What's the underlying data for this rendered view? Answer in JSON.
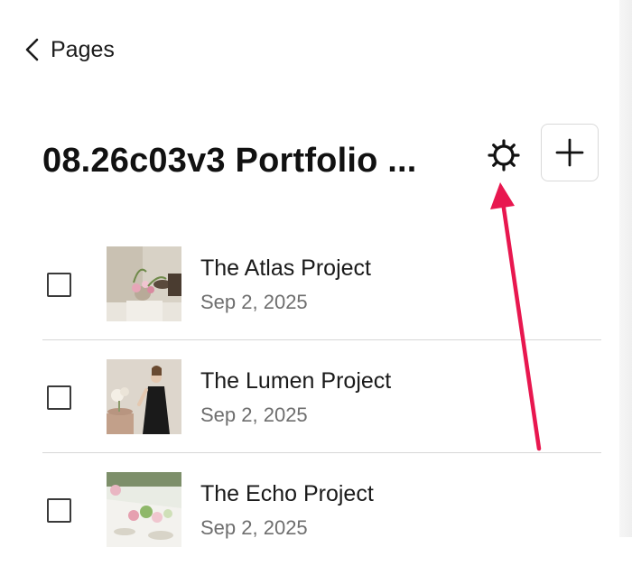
{
  "nav": {
    "back_label": "Pages"
  },
  "header": {
    "title": "08.26c03v3 Portfolio ..."
  },
  "pages": [
    {
      "title": "The Atlas Project",
      "date": "Sep 2, 2025"
    },
    {
      "title": "The Lumen Project",
      "date": "Sep 2, 2025"
    },
    {
      "title": "The Echo Project",
      "date": "Sep 2, 2025"
    }
  ],
  "icons": {
    "back": "chevron-left-icon",
    "settings": "gear-icon",
    "add": "plus-icon"
  },
  "colors": {
    "annotation_arrow": "#e8174f",
    "text_primary": "#111111",
    "text_secondary": "#6e6e6e",
    "divider": "#d6d6d6"
  }
}
